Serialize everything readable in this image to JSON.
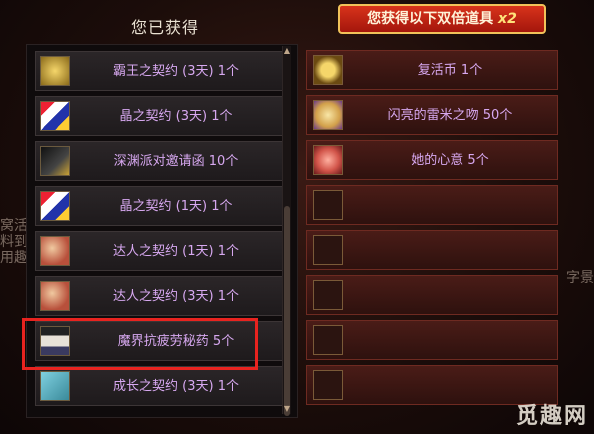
{
  "left": {
    "title": "您已获得",
    "items": [
      {
        "label": "霸王之契约 (3天) 1个",
        "icon": "crown-card-icon",
        "color": "#c9a135"
      },
      {
        "label": "晶之契约 (3天) 1个",
        "icon": "crystal-card-icon",
        "color": "#2a3fa8"
      },
      {
        "label": "深渊派对邀请函 10个",
        "icon": "black-invitation-icon",
        "color": "#2a2424"
      },
      {
        "label": "晶之契约 (1天) 1个",
        "icon": "crystal-card-icon",
        "color": "#2a3fa8"
      },
      {
        "label": "达人之契约 (1天) 1个",
        "icon": "master-card-icon",
        "color": "#b8503b"
      },
      {
        "label": "达人之契约 (3天) 1个",
        "icon": "master-card-icon",
        "color": "#b8503b"
      },
      {
        "label": "魔界抗疲劳秘药 5个",
        "icon": "potion-bottle-icon",
        "color": "#3a3a60"
      },
      {
        "label": "成长之契约 (3天) 1个",
        "icon": "growth-card-icon",
        "color": "#3a8a9a"
      }
    ]
  },
  "right": {
    "banner": "您获得以下双倍道具 ",
    "banner_mult": "x2",
    "items": [
      {
        "label": "复活币 1个",
        "icon": "revive-coin-icon",
        "color": "#c99a35"
      },
      {
        "label": "闪亮的雷米之吻 50个",
        "icon": "kiss-icon",
        "color": "#d2a04a"
      },
      {
        "label": "她的心意 5个",
        "icon": "heart-icon",
        "color": "#d2554a"
      },
      {
        "label": "",
        "icon": "empty-slot-icon",
        "color": "#2b1410"
      },
      {
        "label": "",
        "icon": "empty-slot-icon",
        "color": "#2b1410"
      },
      {
        "label": "",
        "icon": "empty-slot-icon",
        "color": "#2b1410"
      },
      {
        "label": "",
        "icon": "empty-slot-icon",
        "color": "#2b1410"
      },
      {
        "label": "",
        "icon": "empty-slot-icon",
        "color": "#2b1410"
      }
    ]
  },
  "background": {
    "left_text": "窝活料到用趣",
    "right_text": "字景"
  },
  "watermark": "觅趣网"
}
